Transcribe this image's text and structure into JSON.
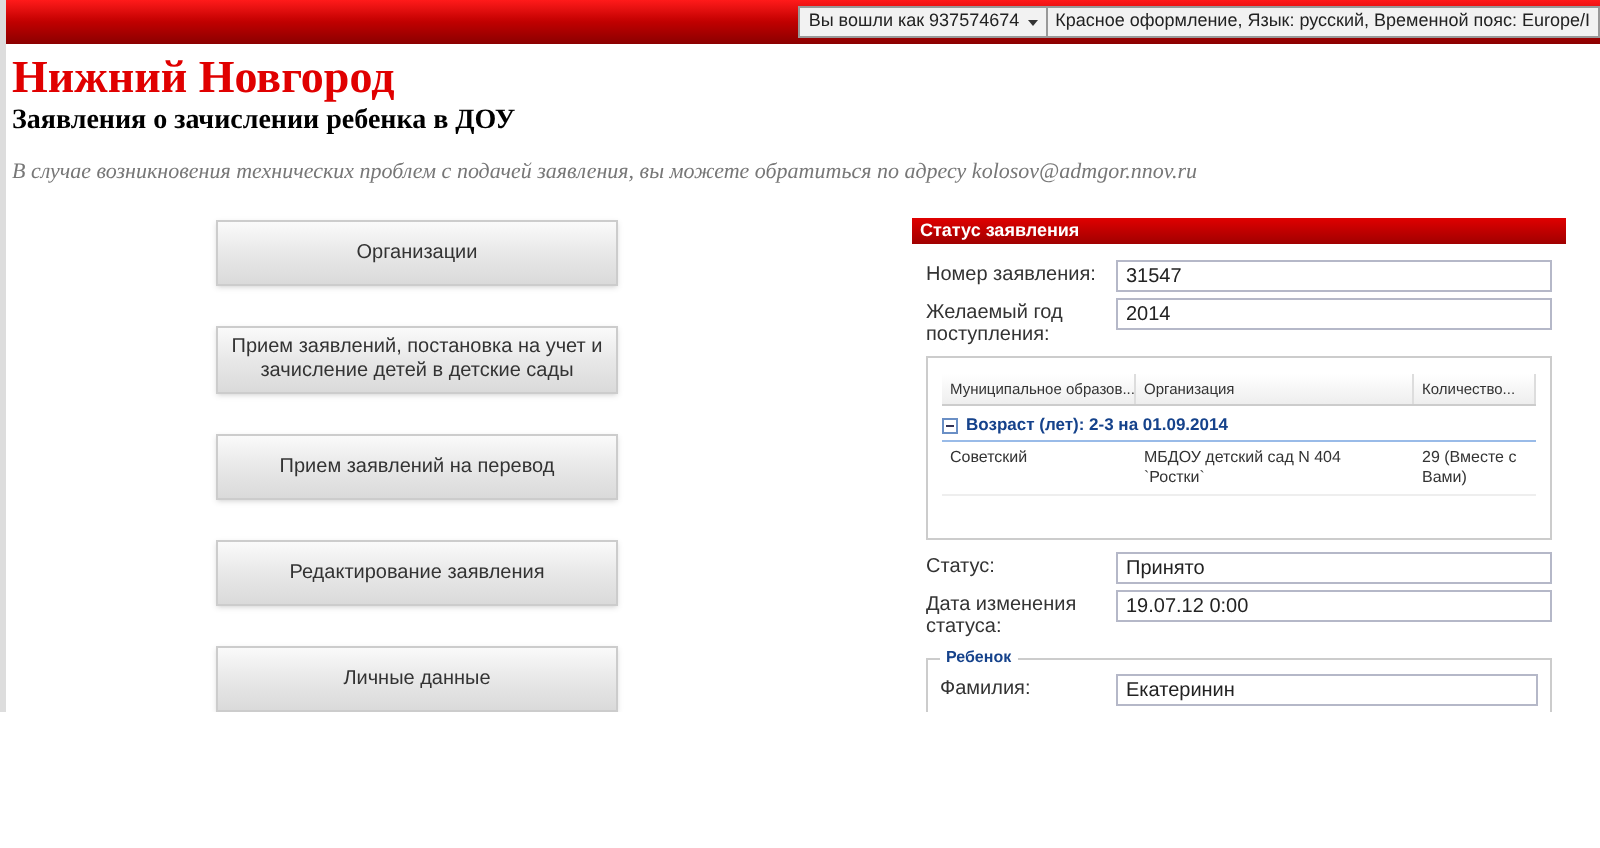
{
  "top_bar": {
    "user_menu": "Вы вошли как 937574674",
    "settings": "Красное оформление, Язык: русский, Временной пояс: Europe/I"
  },
  "header": {
    "title": "Нижний Новгород",
    "subtitle": "Заявления о зачислении ребенка в ДОУ",
    "notice": "В случае возникновения технических проблем с подачей заявления, вы можете обратиться по адресу kolosov@admgor.nnov.ru"
  },
  "menu_buttons": [
    "Организации",
    "Прием заявлений, постановка на учет и зачисление детей в детские сады",
    "Прием заявлений на перевод",
    "Редактирование заявления",
    "Личные данные"
  ],
  "status_panel": {
    "title": "Статус заявления",
    "fields_top": [
      {
        "label": "Номер заявления:",
        "value": "31547"
      },
      {
        "label": "Желаемый год поступления:",
        "value": "2014"
      }
    ],
    "table": {
      "columns": [
        "Муниципальное образов...",
        "Организация",
        "Количество..."
      ],
      "groups": [
        {
          "title": "Возраст (лет): 2-3 на 01.09.2014",
          "expanded": true,
          "rows": [
            [
              "Советский",
              "МБДОУ детский сад N 404 `Ростки`",
              "29 (Вместе с Вами)"
            ]
          ]
        }
      ]
    },
    "fields_bottom": [
      {
        "label": "Статус:",
        "value": "Принято"
      },
      {
        "label": "Дата изменения статуса:",
        "value": "19.07.12 0:00"
      }
    ],
    "child": {
      "legend": "Ребенок",
      "fields": [
        {
          "label": "Фамилия:",
          "value": "Екатеринин"
        }
      ]
    }
  }
}
